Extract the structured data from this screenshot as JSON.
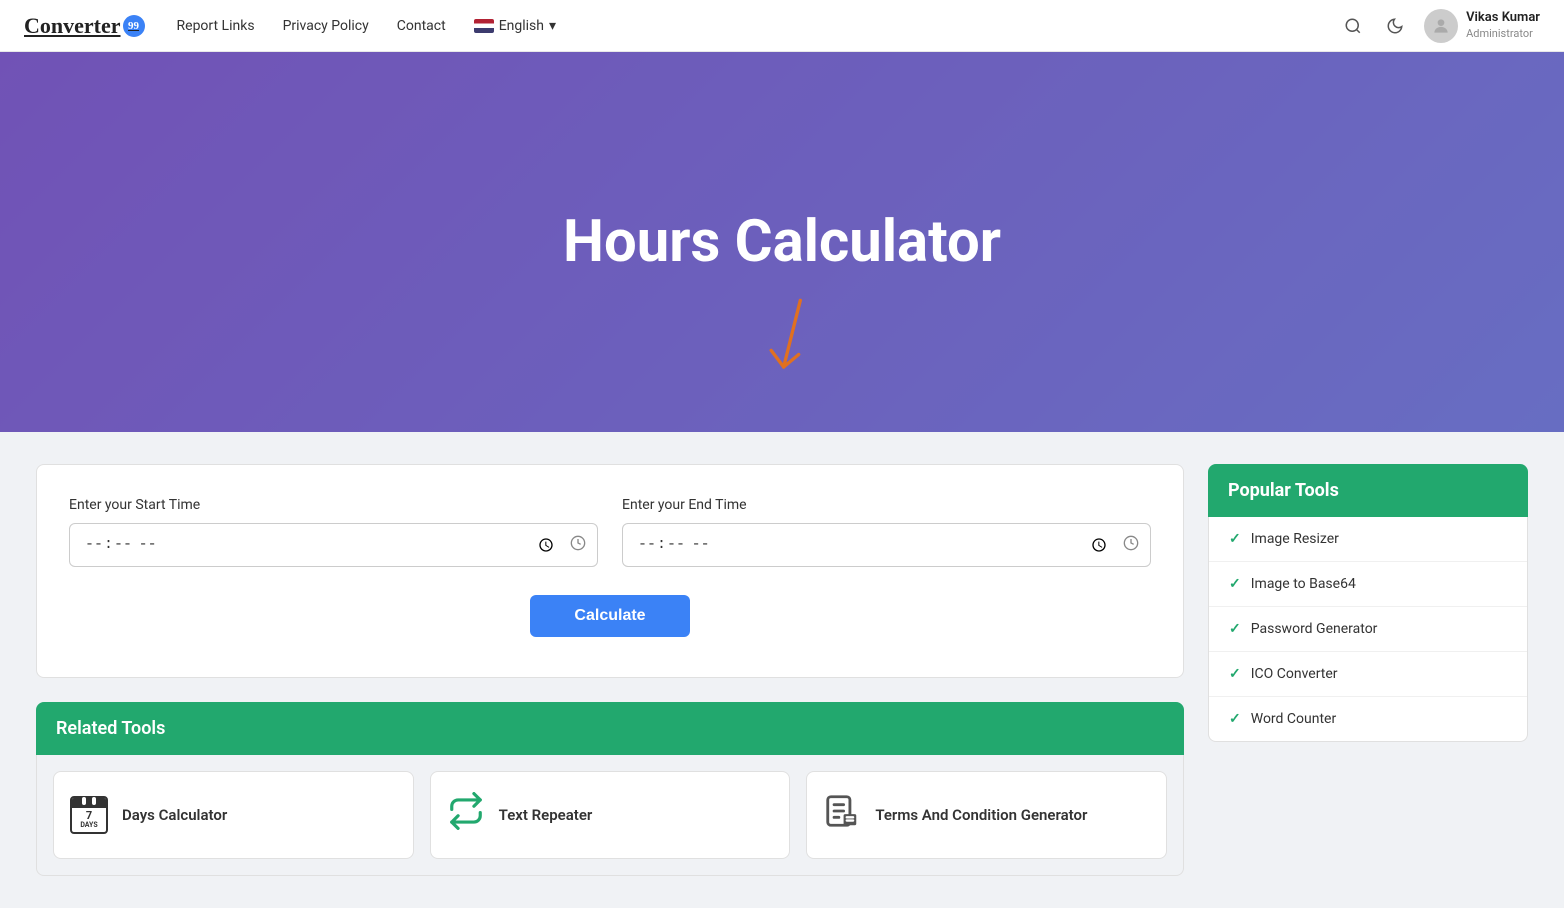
{
  "navbar": {
    "logo_text": "Converter",
    "logo_badge": "99",
    "links": [
      {
        "label": "Report Links",
        "href": "#"
      },
      {
        "label": "Privacy Policy",
        "href": "#"
      },
      {
        "label": "Contact",
        "href": "#"
      }
    ],
    "language": "English",
    "user_name": "Vikas Kumar",
    "user_role": "Administrator",
    "search_icon": "search-icon",
    "dark_mode_icon": "moon-icon"
  },
  "hero": {
    "title": "Hours Calculator",
    "arrow_label": "scroll-down-arrow"
  },
  "calculator": {
    "start_time_label": "Enter your Start Time",
    "start_time_placeholder": "--:-- --",
    "end_time_label": "Enter your End Time",
    "end_time_placeholder": "--:-- --",
    "calculate_button": "Calculate"
  },
  "related_tools": {
    "header": "Related Tools",
    "items": [
      {
        "label": "Days Calculator",
        "icon_type": "calendar",
        "sub_label": "DAYS"
      },
      {
        "label": "Text Repeater",
        "icon_type": "repeat"
      },
      {
        "label": "Terms And Condition Generator",
        "icon_type": "terms"
      }
    ]
  },
  "sidebar": {
    "header": "Popular Tools",
    "items": [
      {
        "label": "Image Resizer"
      },
      {
        "label": "Image to Base64"
      },
      {
        "label": "Password Generator"
      },
      {
        "label": "ICO Converter"
      },
      {
        "label": "Word Counter"
      }
    ]
  }
}
